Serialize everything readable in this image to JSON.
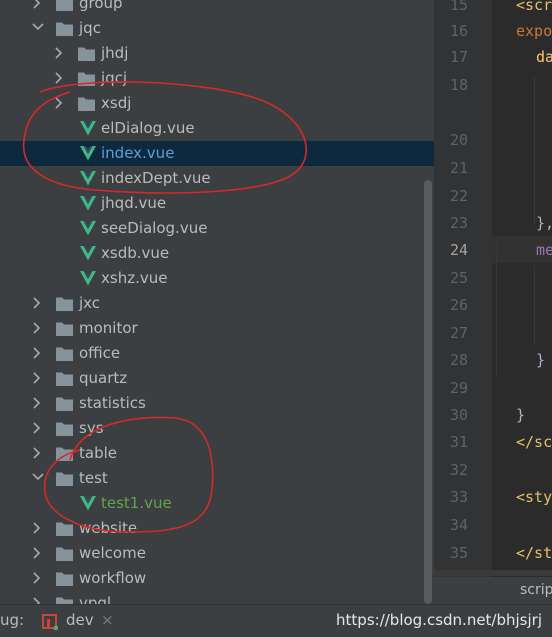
{
  "tree": {
    "items": [
      {
        "label": "group",
        "kind": "folder",
        "depth": 1,
        "expanded": false
      },
      {
        "label": "jqc",
        "kind": "folder",
        "depth": 1,
        "expanded": true
      },
      {
        "label": "jhdj",
        "kind": "folder",
        "depth": 2,
        "expanded": false
      },
      {
        "label": "jqcj",
        "kind": "folder",
        "depth": 2,
        "expanded": false
      },
      {
        "label": "xsdj",
        "kind": "folder",
        "depth": 2,
        "expanded": false
      },
      {
        "label": "elDialog.vue",
        "kind": "vue",
        "depth": 3
      },
      {
        "label": "index.vue",
        "kind": "vue",
        "depth": 3,
        "selected": true
      },
      {
        "label": "indexDept.vue",
        "kind": "vue",
        "depth": 3
      },
      {
        "label": "jhqd.vue",
        "kind": "vue",
        "depth": 3
      },
      {
        "label": "seeDialog.vue",
        "kind": "vue",
        "depth": 3
      },
      {
        "label": "xsdb.vue",
        "kind": "vue",
        "depth": 3
      },
      {
        "label": "xshz.vue",
        "kind": "vue",
        "depth": 3
      },
      {
        "label": "jxc",
        "kind": "folder",
        "depth": 1,
        "expanded": false
      },
      {
        "label": "monitor",
        "kind": "folder",
        "depth": 1,
        "expanded": false
      },
      {
        "label": "office",
        "kind": "folder",
        "depth": 1,
        "expanded": false
      },
      {
        "label": "quartz",
        "kind": "folder",
        "depth": 1,
        "expanded": false
      },
      {
        "label": "statistics",
        "kind": "folder",
        "depth": 1,
        "expanded": false
      },
      {
        "label": "sys",
        "kind": "folder",
        "depth": 1,
        "expanded": false
      },
      {
        "label": "table",
        "kind": "folder",
        "depth": 1,
        "expanded": false
      },
      {
        "label": "test",
        "kind": "folder",
        "depth": 1,
        "expanded": true
      },
      {
        "label": "test1.vue",
        "kind": "vue",
        "depth": 2,
        "green": true
      },
      {
        "label": "website",
        "kind": "folder",
        "depth": 1,
        "expanded": false
      },
      {
        "label": "welcome",
        "kind": "folder",
        "depth": 1,
        "expanded": false
      },
      {
        "label": "workflow",
        "kind": "folder",
        "depth": 1,
        "expanded": false
      },
      {
        "label": "ypgl",
        "kind": "folder",
        "depth": 1,
        "expanded": false
      }
    ]
  },
  "editor": {
    "line_numbers": [
      "15",
      "16",
      "17",
      "18",
      "20",
      "21",
      "22",
      "23",
      "24",
      "25",
      "26",
      "27",
      "28",
      "29",
      "30",
      "31",
      "32",
      "33",
      "34",
      "35"
    ],
    "current_line": "24",
    "code": [
      {
        "line": "15",
        "text": "<scr",
        "color": "#e8bf6a",
        "indent": 0
      },
      {
        "line": "16",
        "text": "expo",
        "color": "#cc7832",
        "indent": 0
      },
      {
        "line": "17",
        "text": "da",
        "color": "#ffc66d",
        "indent": 1
      },
      {
        "line": "23",
        "text": "},",
        "color": "#a9b7c6",
        "indent": 1
      },
      {
        "line": "24",
        "text": "me",
        "color": "#9876aa",
        "indent": 1
      },
      {
        "line": "28",
        "text": "}",
        "color": "#a9b7c6",
        "indent": 1
      },
      {
        "line": "30",
        "text": "}",
        "color": "#a9b7c6",
        "indent": 0
      },
      {
        "line": "31",
        "text": "</sc",
        "color": "#e8bf6a",
        "indent": 0
      },
      {
        "line": "33",
        "text": "<sty",
        "color": "#e8bf6a",
        "indent": 0
      },
      {
        "line": "35",
        "text": "</st",
        "color": "#e8bf6a",
        "indent": 0
      }
    ],
    "tab_label": "scrip"
  },
  "statusbar": {
    "debug_label": "ug:",
    "config_label": "dev",
    "close_glyph": "×",
    "watermark": "https://blog.csdn.net/bhjsjrj"
  },
  "colors": {
    "vue_icon": "#41b883",
    "folder_icon": "#87939a",
    "selected_row": "#0d293e",
    "annotation": "#d42a2a"
  }
}
